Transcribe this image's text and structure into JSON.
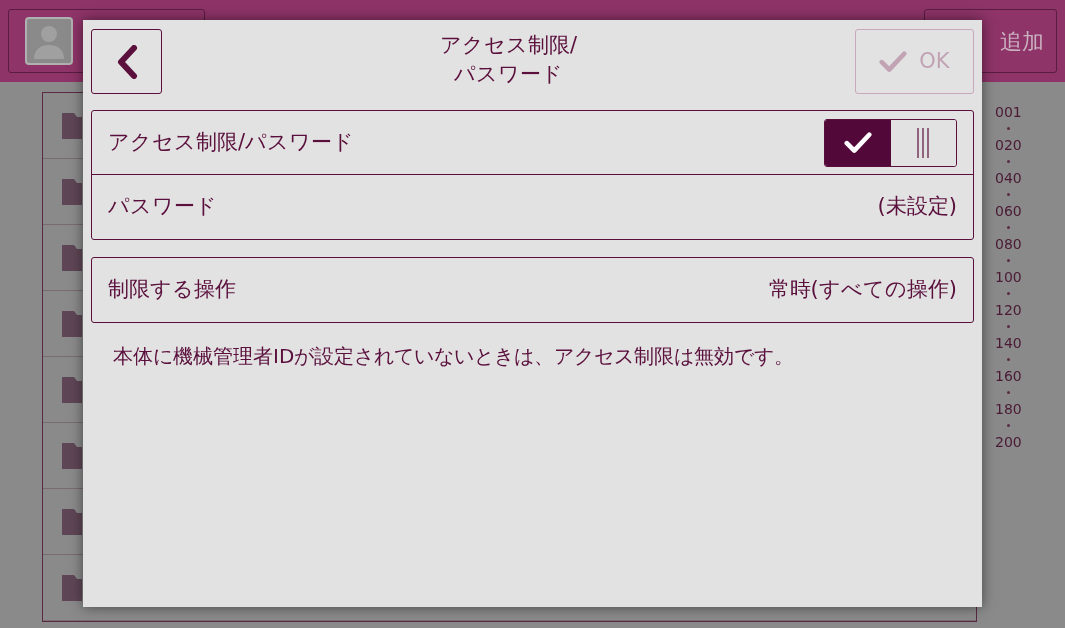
{
  "header": {
    "add_button": "追加"
  },
  "index": [
    "001",
    "020",
    "040",
    "060",
    "080",
    "100",
    "120",
    "140",
    "160",
    "180",
    "200"
  ],
  "dialog": {
    "title_lines": [
      "アクセス制限/",
      "パスワード"
    ],
    "ok_button": {
      "label": "OK",
      "disabled": true
    },
    "groups": [
      [
        {
          "kind": "toggle",
          "label": "アクセス制限/パスワード",
          "on": true
        },
        {
          "kind": "value",
          "label": "パスワード",
          "value": "(未設定)"
        }
      ],
      [
        {
          "kind": "value",
          "label": "制限する操作",
          "value": "常時(すべての操作)"
        }
      ]
    ],
    "note": "本体に機械管理者IDが設定されていないときは、アクセス制限は無効です。"
  }
}
